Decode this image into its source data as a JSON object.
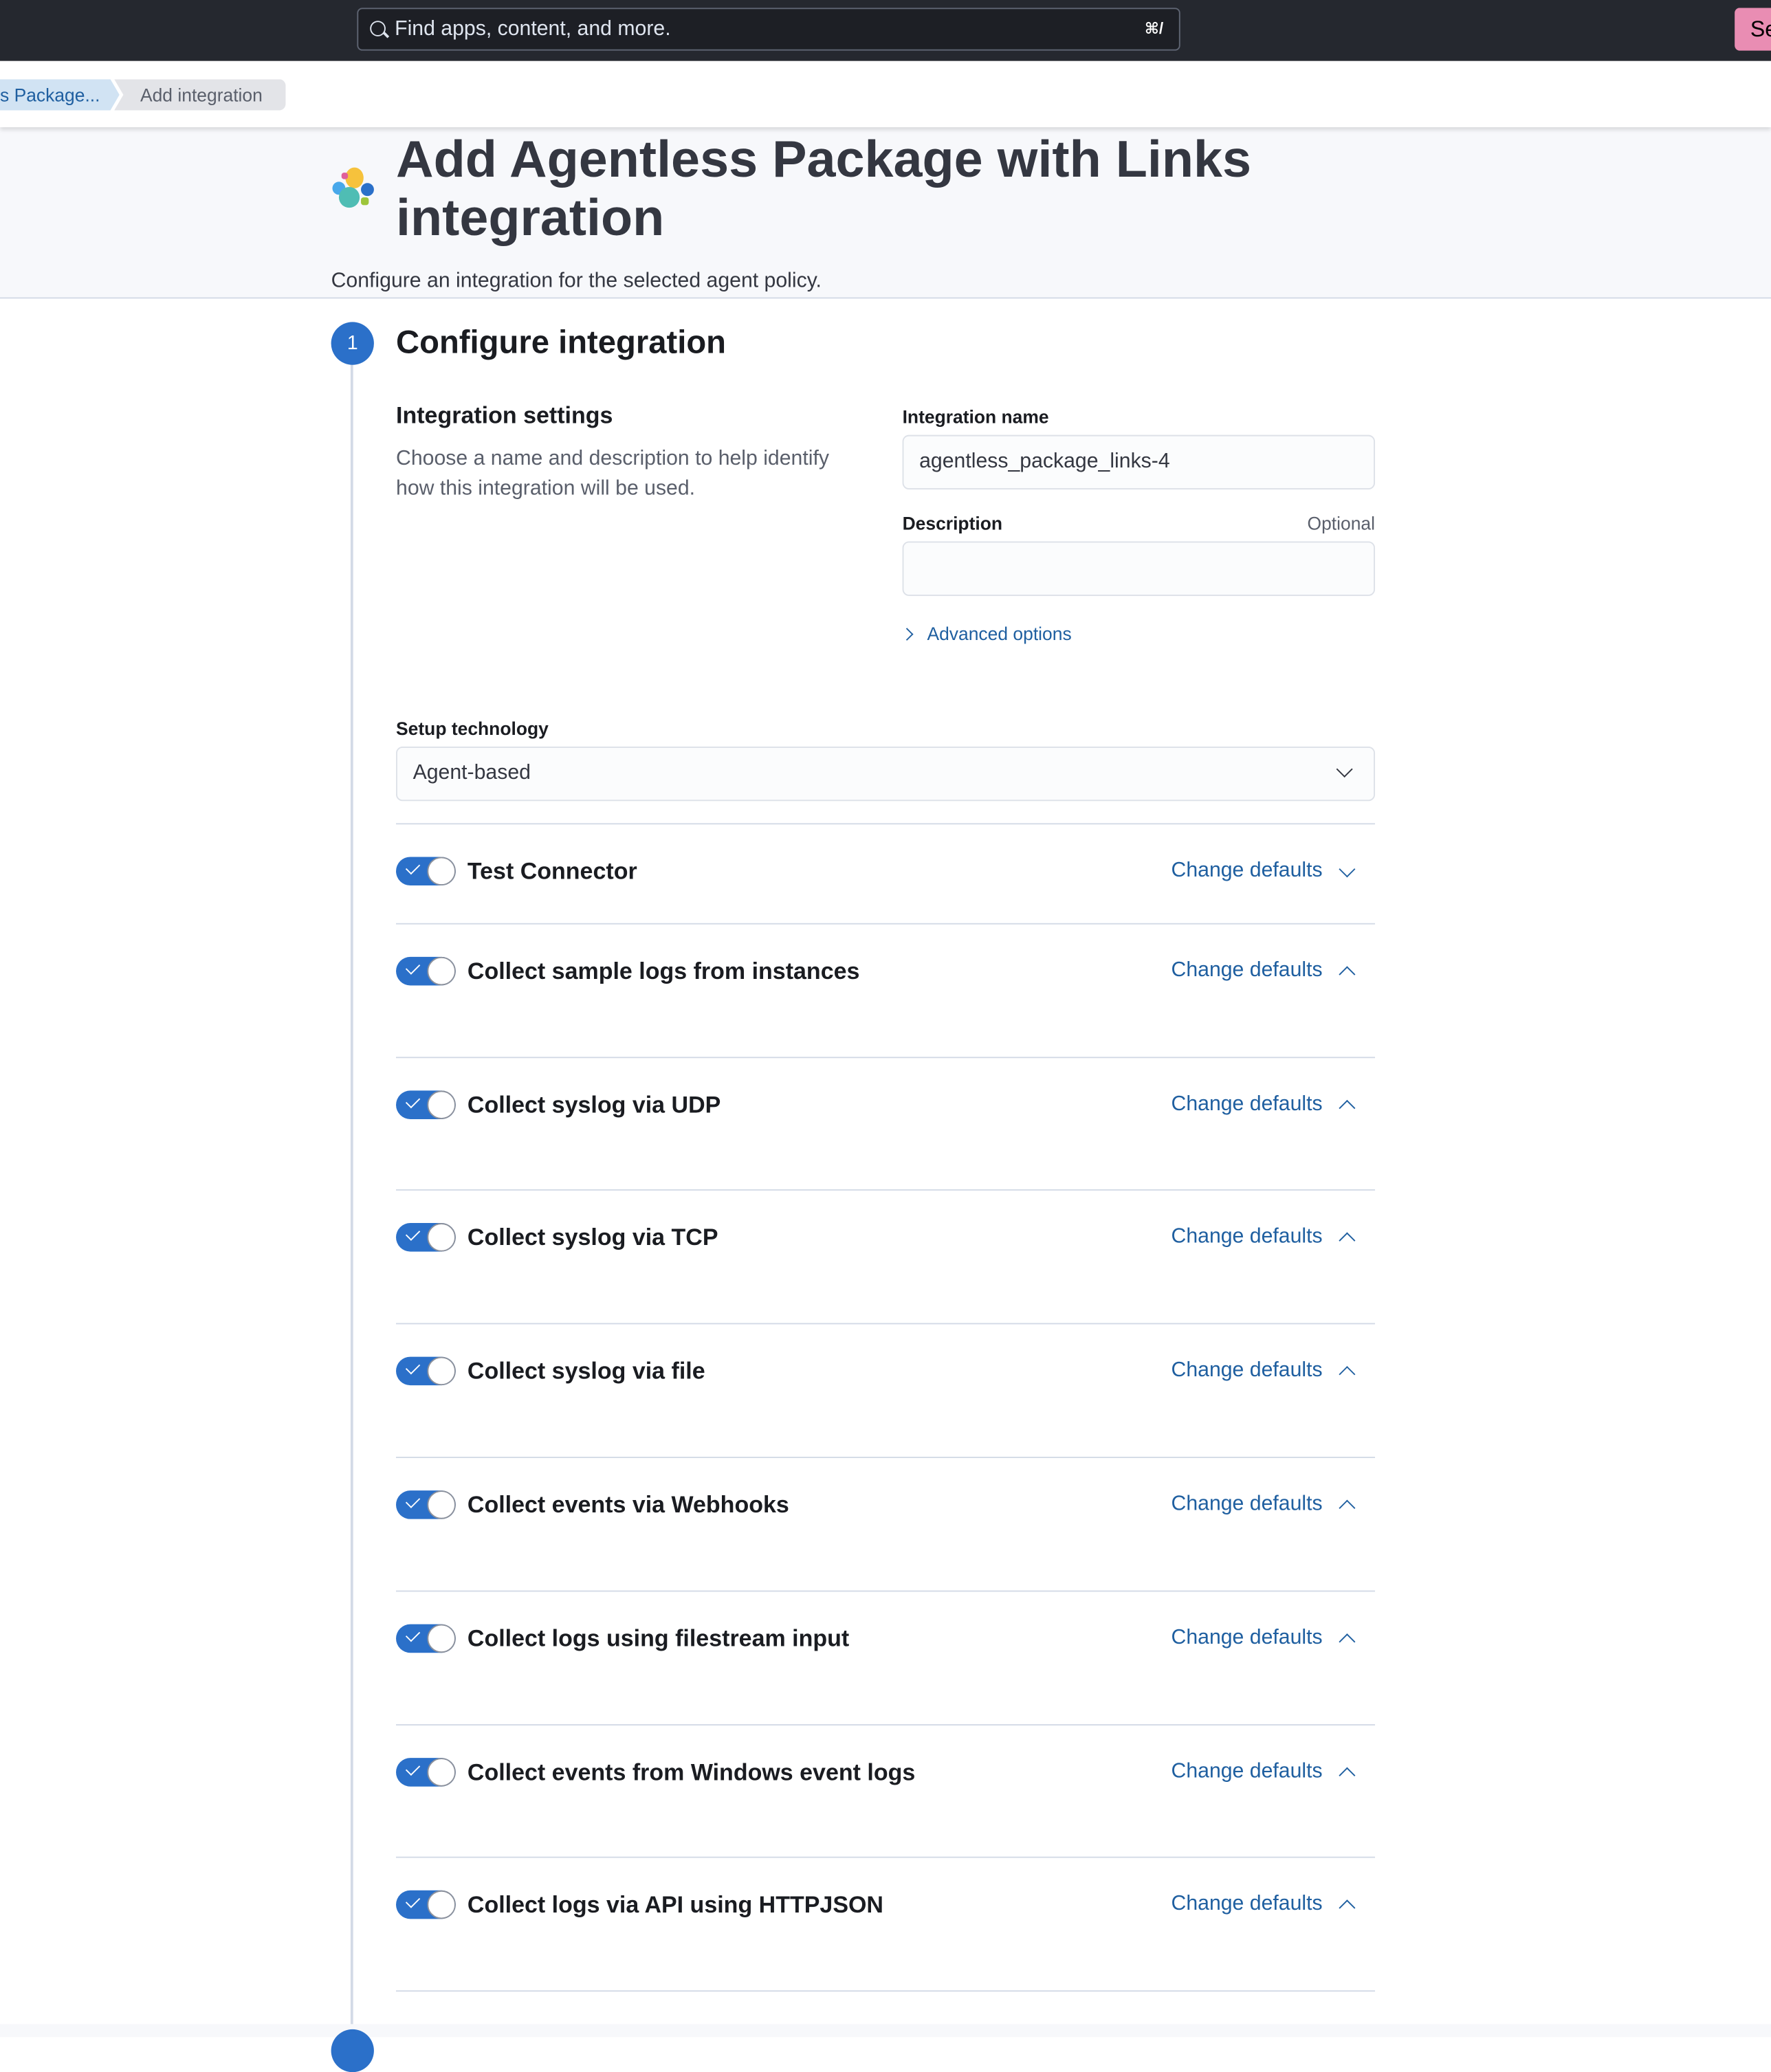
{
  "topbar": {
    "search_placeholder": "Find apps, content, and more.",
    "shortcut": "⌘/",
    "button_label": "Se",
    "button_color": "#e98db3"
  },
  "breadcrumbs": [
    {
      "label": "s Package..."
    },
    {
      "label": "Add integration"
    }
  ],
  "header": {
    "title": "Add Agentless Package with Links integration",
    "subtitle": "Configure an integration for the selected agent policy.",
    "logo_icon": "elastic-logo-icon"
  },
  "step": {
    "number": "1",
    "title": "Configure integration"
  },
  "settings": {
    "title": "Integration settings",
    "description": "Choose a name and description to help identify how this integration will be used.",
    "name_label": "Integration name",
    "name_value": "agentless_package_links-4",
    "description_label": "Description",
    "optional_label": "Optional",
    "description_value": "",
    "advanced_options": "Advanced options"
  },
  "setup": {
    "label": "Setup technology",
    "selected": "Agent-based"
  },
  "inputs": [
    {
      "title": "Test Connector",
      "enabled": true,
      "action": "Change defaults",
      "expanded": false
    },
    {
      "title": "Collect sample logs from instances",
      "enabled": true,
      "action": "Change defaults",
      "expanded": true
    },
    {
      "title": "Collect syslog via UDP",
      "enabled": true,
      "action": "Change defaults",
      "expanded": true
    },
    {
      "title": "Collect syslog via TCP",
      "enabled": true,
      "action": "Change defaults",
      "expanded": true
    },
    {
      "title": "Collect syslog via file",
      "enabled": true,
      "action": "Change defaults",
      "expanded": true
    },
    {
      "title": "Collect events via Webhooks",
      "enabled": true,
      "action": "Change defaults",
      "expanded": true
    },
    {
      "title": "Collect logs using filestream input",
      "enabled": true,
      "action": "Change defaults",
      "expanded": true
    },
    {
      "title": "Collect events from Windows event logs",
      "enabled": true,
      "action": "Change defaults",
      "expanded": true
    },
    {
      "title": "Collect logs via API using HTTPJSON",
      "enabled": true,
      "action": "Change defaults",
      "expanded": true
    }
  ],
  "colors": {
    "accent": "#2b70c9",
    "link": "#1f5fa0",
    "topbar": "#25282f"
  }
}
